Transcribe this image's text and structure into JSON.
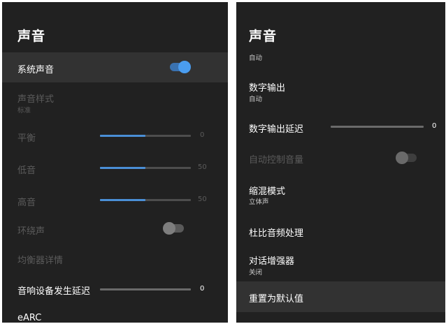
{
  "left": {
    "title": "声音",
    "items": {
      "system_sound": {
        "label": "系统声音",
        "toggle_on": true
      },
      "sound_style": {
        "label": "声音样式",
        "value": "标准"
      },
      "balance": {
        "label": "平衡",
        "value": "0",
        "level_percent": 50
      },
      "bass": {
        "label": "低音",
        "value": "50",
        "level_percent": 50
      },
      "treble": {
        "label": "高音",
        "value": "50",
        "level_percent": 50
      },
      "surround": {
        "label": "环绕声",
        "toggle_on": false
      },
      "eq_details": {
        "label": "均衡器详情"
      },
      "speaker_delay": {
        "label": "音响设备发生延迟",
        "value": "0",
        "level_percent": 0
      },
      "earc": {
        "label": "eARC"
      }
    }
  },
  "right": {
    "title": "声音",
    "items": {
      "top_sub": {
        "value": "自动"
      },
      "digital_output": {
        "label": "数字输出",
        "value": "自动"
      },
      "digital_output_delay": {
        "label": "数字输出延迟",
        "value": "0",
        "level_percent": 0
      },
      "auto_volume": {
        "label": "自动控制音量",
        "toggle_on": false
      },
      "downmix": {
        "label": "缩混模式",
        "value": "立体声"
      },
      "dolby": {
        "label": "杜比音频处理"
      },
      "dialogue": {
        "label": "对话增强器",
        "value": "关闭"
      },
      "reset": {
        "label": "重置为默认值"
      }
    }
  },
  "colors": {
    "panel_bg": "#212121",
    "highlight_bg": "#323232",
    "accent": "#4a9df0",
    "disabled_text": "#5b5b5b"
  }
}
